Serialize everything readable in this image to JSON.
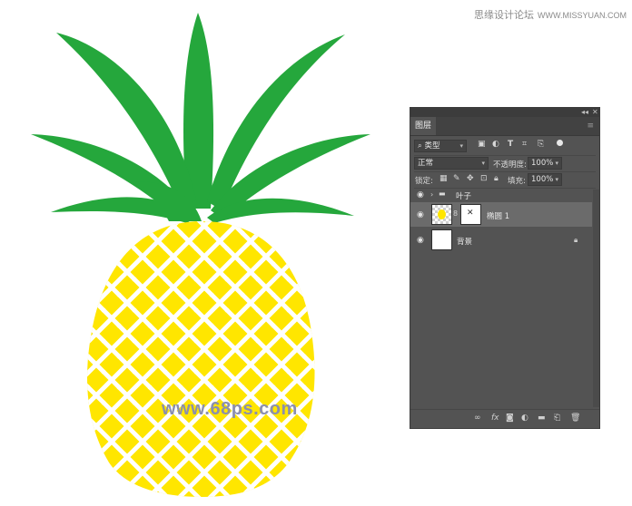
{
  "watermark_top": {
    "text": "思缘设计论坛",
    "site": "WWW.MISSYUAN.COM"
  },
  "watermark_center": "www.68ps.com",
  "colors": {
    "leaf": "#25a73c",
    "fruit": "#ffe600",
    "panel_bg": "#535353",
    "selected_row": "#6b6b6b"
  },
  "panel": {
    "window_controls": [
      "◂◂",
      "✕"
    ],
    "tab_label": "图层",
    "menu_icon": "hamburger-icon",
    "filter": {
      "kind_label": "类型",
      "icons": [
        "image-filter-icon",
        "adjustment-filter-icon",
        "type-filter-icon",
        "shape-filter-icon",
        "smart-object-filter-icon"
      ]
    },
    "blend_mode": "正常",
    "opacity": {
      "label": "不透明度:",
      "value": "100%"
    },
    "lock": {
      "label": "锁定:",
      "icons": [
        "lock-transparent-icon",
        "lock-paint-icon",
        "lock-move-icon",
        "lock-artboard-icon",
        "lock-all-icon"
      ]
    },
    "fill": {
      "label": "填充:",
      "value": "100%"
    },
    "layers": [
      {
        "name": "叶子",
        "type": "group",
        "visible": true,
        "selected": false
      },
      {
        "name": "椭圆 1",
        "type": "shape",
        "visible": true,
        "selected": true,
        "has_mask": true
      },
      {
        "name": "背景",
        "type": "background",
        "visible": true,
        "selected": false,
        "locked": true
      }
    ],
    "bottom_icons": [
      "link-icon",
      "fx-icon",
      "mask-icon",
      "adjustment-icon",
      "folder-icon",
      "new-layer-icon",
      "trash-icon"
    ]
  }
}
